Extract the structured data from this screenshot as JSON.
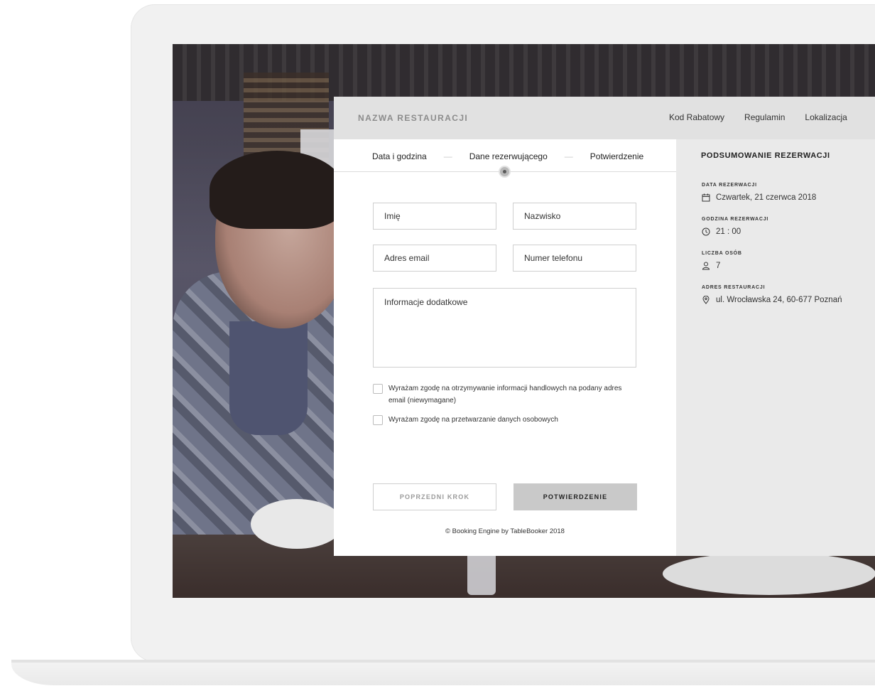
{
  "header": {
    "restaurant_name": "NAZWA RESTAURACJI",
    "nav": [
      "Kod Rabatowy",
      "Regulamin",
      "Lokalizacja"
    ]
  },
  "steps": [
    "Data i godzina",
    "Dane rezerwującego",
    "Potwierdzenie"
  ],
  "form": {
    "first_name_placeholder": "Imię",
    "last_name_placeholder": "Nazwisko",
    "email_placeholder": "Adres email",
    "phone_placeholder": "Numer telefonu",
    "notes_placeholder": "Informacje dodatkowe",
    "consent_marketing": "Wyrażam zgodę na otrzymywanie informacji handlowych na podany adres email (niewymagane)",
    "consent_data": "Wyrażam zgodę na przetwarzanie danych osobowych",
    "prev_button": "POPRZEDNI KROK",
    "confirm_button": "POTWIERDZENIE"
  },
  "footer": "© Booking Engine by TableBooker 2018",
  "summary": {
    "title": "PODSUMOWANIE REZERWACJI",
    "date_label": "DATA REZERWACJI",
    "date_value": "Czwartek, 21 czerwca 2018",
    "time_label": "GODZINA REZERWACJI",
    "time_value": "21 : 00",
    "people_label": "LICZBA OSÓB",
    "people_value": "7",
    "address_label": "ADRES RESTAURACJI",
    "address_value": "ul. Wrocławska 24, 60-677 Poznań"
  },
  "colors": {
    "topbar": "#e1e1e1",
    "summary_bg": "#eaeaea",
    "confirm_button": "#c9c9c9",
    "photo_overlay": "#46446099"
  },
  "icons": {
    "date": "calendar-icon",
    "time": "clock-icon",
    "people": "user-icon",
    "address": "map-pin-icon"
  }
}
